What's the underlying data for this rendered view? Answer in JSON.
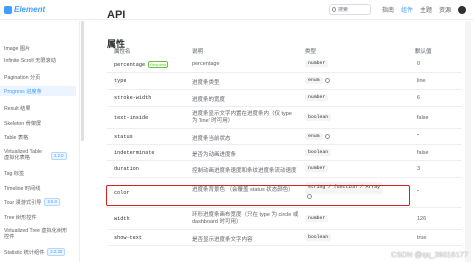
{
  "header": {
    "logo": "Element",
    "search_placeholder": "搜索",
    "nav": [
      "指南",
      "组件",
      "主题",
      "资源"
    ]
  },
  "sidebar": {
    "items": [
      {
        "label": "Image 图片"
      },
      {
        "label": "Infinite Scroll 无限滚动"
      },
      {
        "label": "Pagination 分页"
      },
      {
        "label": "Progress 进度条",
        "active": true
      },
      {
        "label": "Result 结果"
      },
      {
        "label": "Skeleton 骨架屏"
      },
      {
        "label": "Table 表格"
      },
      {
        "label": "Virtualized Table 虚拟化表格",
        "badge": "2.2.0"
      },
      {
        "label": "Tag 标签"
      },
      {
        "label": "Timeline 时间线"
      },
      {
        "label": "Tour 漫游式引导",
        "badge": "2.5.0"
      },
      {
        "label": "Tree 树形控件"
      },
      {
        "label": "Virtualized Tree 虚拟化树形控件"
      },
      {
        "label": "Statistic 统计组件",
        "badge": "2.2.30"
      }
    ]
  },
  "main": {
    "title": "API",
    "section": "属性",
    "headers": [
      "属性名",
      "说明",
      "类型",
      "默认值"
    ],
    "rows": [
      {
        "name": "percentage",
        "required": "Required",
        "desc": "percentage",
        "type": "number",
        "default": "0"
      },
      {
        "name": "type",
        "desc": "进度条类型",
        "type": "enum",
        "default": "line"
      },
      {
        "name": "stroke-width",
        "desc": "进度条的宽度",
        "type": "number",
        "default": "6"
      },
      {
        "name": "text-inside",
        "desc": "进度条显示文字内置在进度条内（仅 type 为 'line' 时可用）",
        "type": "boolean",
        "default": "false"
      },
      {
        "name": "status",
        "desc": "进度条当前状态",
        "type": "enum",
        "default": "''"
      },
      {
        "name": "indeterminate",
        "desc": "是否为动画进度条",
        "type": "boolean",
        "default": "false"
      },
      {
        "name": "duration",
        "desc": "控制动画进度条速度和条纹进度条流动速度",
        "type": "number",
        "default": "3"
      },
      {
        "name": "color",
        "desc": "进度条背景色 （会覆盖 status 状态颜色）",
        "type": "string / function / Array",
        "default": "''"
      },
      {
        "name": "width",
        "desc": "环形进度条画布宽度（只在 type 为 circle 或 dashboard 时可用）",
        "type": "number",
        "default": "126"
      },
      {
        "name": "show-text",
        "desc": "是否显示进度条文字内容",
        "type": "boolean",
        "default": "true"
      }
    ]
  },
  "watermark": "CSDN @qq_39016177",
  "colors": {
    "accent": "#409eff",
    "highlight_border": "#d3231c",
    "required": "#67c23a"
  }
}
